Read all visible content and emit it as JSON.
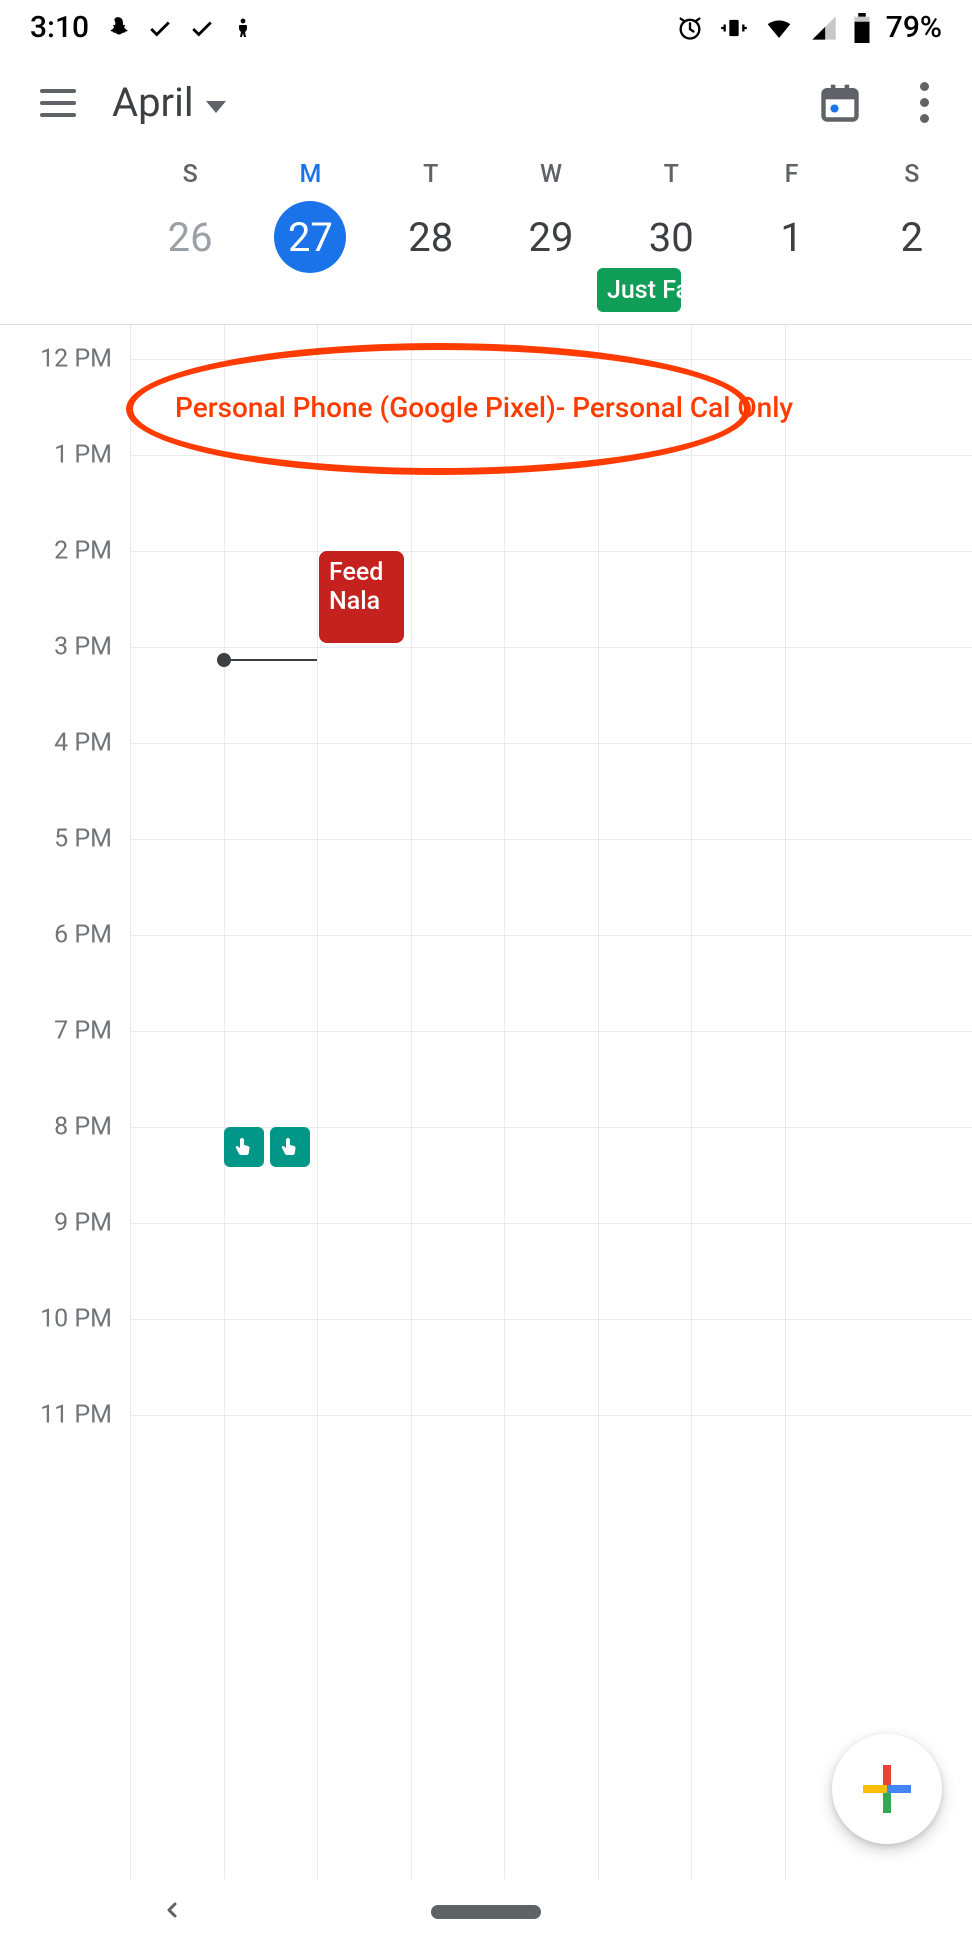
{
  "status": {
    "time": "3:10",
    "battery": "79%",
    "icons_left": [
      "snapchat-icon",
      "check-icon",
      "check-icon",
      "figure-icon"
    ],
    "icons_right": [
      "alarm-icon",
      "vibrate-icon",
      "wifi-icon",
      "cell-icon",
      "battery-icon"
    ]
  },
  "appbar": {
    "month": "April"
  },
  "week": {
    "days": [
      {
        "dow": "S",
        "num": "26",
        "state": "prev"
      },
      {
        "dow": "M",
        "num": "27",
        "state": "selected"
      },
      {
        "dow": "T",
        "num": "28",
        "state": ""
      },
      {
        "dow": "W",
        "num": "29",
        "state": ""
      },
      {
        "dow": "T",
        "num": "30",
        "state": ""
      },
      {
        "dow": "F",
        "num": "1",
        "state": ""
      },
      {
        "dow": "S",
        "num": "2",
        "state": ""
      }
    ],
    "allday": {
      "label": "Just Fa"
    }
  },
  "timegrid": {
    "hours": [
      "12 PM",
      "1 PM",
      "2 PM",
      "3 PM",
      "4 PM",
      "5 PM",
      "6 PM",
      "7 PM",
      "8 PM",
      "9 PM",
      "10 PM",
      "11 PM"
    ],
    "events": [
      {
        "title": "Feed Nala"
      }
    ],
    "annotation": "Personal Phone (Google Pixel)- Personal Cal Only"
  }
}
